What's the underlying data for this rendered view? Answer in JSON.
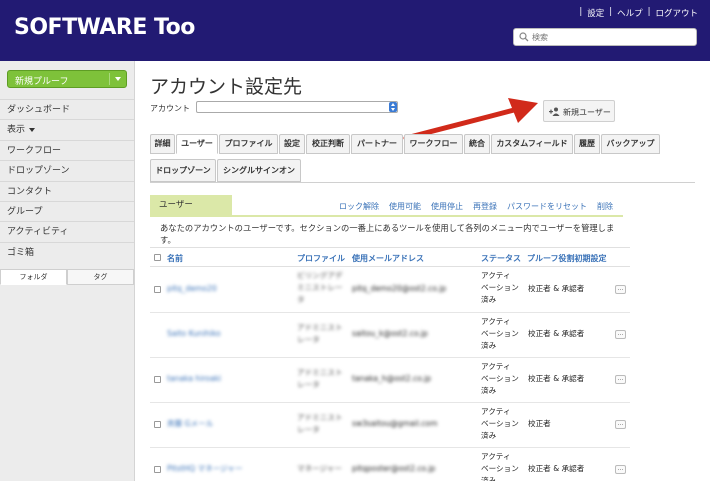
{
  "header": {
    "logo": "SOFTWARE Too",
    "links": [
      "|",
      "設定",
      "|",
      "ヘルプ",
      "|",
      "ログアウト"
    ],
    "search_placeholder": "検索"
  },
  "sidebar": {
    "new_flow_label": "新規プルーフ",
    "items": [
      "ダッシュボード",
      "表示",
      "ワークフロー",
      "ドロップゾーン",
      "コンタクト",
      "グループ",
      "アクティビティ",
      "ゴミ箱"
    ],
    "tabs": [
      "フォルダ",
      "タグ"
    ]
  },
  "main": {
    "title": "アカウント設定先",
    "account_label": "アカウント",
    "new_user_button": "新規ユーザー",
    "tabs": [
      "詳細",
      "ユーザー",
      "プロファイル",
      "設定",
      "校正判断",
      "パートナー",
      "ワークフロー",
      "統合",
      "カスタムフィールド",
      "履歴",
      "バックアップ",
      "ドロップゾーン",
      "シングルサインオン"
    ],
    "active_tab": "ユーザー",
    "section_title": "ユーザー",
    "actions": [
      "ロック解除",
      "使用可能",
      "使用停止",
      "再登録",
      "パスワードをリセット",
      "削除"
    ],
    "description": "あなたのアカウントのユーザーです。セクションの一番上にあるツールを使用して各列のメニュー内でユーザーを管理します。"
  },
  "table": {
    "headers": [
      "名前",
      "プロファイル",
      "使用メールアドレス",
      "ステータス",
      "プルーフ役割初期設定"
    ],
    "rows": [
      {
        "name": "pitq_demo20",
        "profile": [
          "ビリングアデ",
          "ミニストレー",
          "タ"
        ],
        "email": "pitq_demo20@ost2.co.jp",
        "status": [
          "アクティ",
          "ベーション",
          "済み"
        ],
        "role": "校正者 & 承認者",
        "more": "..."
      },
      {
        "name": "Saito Kunihiko",
        "profile": [
          "アドミニスト",
          "レータ"
        ],
        "email": "saitou_k@ost2.co.jp",
        "status": [
          "アクティ",
          "ベーション",
          "済み"
        ],
        "role": "校正者 & 承認者",
        "more": "..."
      },
      {
        "name": "tanaka hiroaki",
        "profile": [
          "アドミニスト",
          "レータ"
        ],
        "email": "tanaka_h@ost2.co.jp",
        "status": [
          "アクティ",
          "ベーション",
          "済み"
        ],
        "role": "校正者 & 承認者",
        "more": "..."
      },
      {
        "name": "斉藤 Gメール",
        "profile": [
          "アドミニスト",
          "レータ"
        ],
        "email": "sw3saitou@gmail.com",
        "status": [
          "アクティ",
          "ベーション",
          "済み"
        ],
        "role": "校正者",
        "more": "..."
      },
      {
        "name": "PitstHQ マネージャー",
        "profile": [
          "マネージャー"
        ],
        "email": "pitqposter@ost2.co.jp",
        "status": [
          "アクティ",
          "ベーション",
          "済み"
        ],
        "role": "校正者 & 承認者",
        "more": "..."
      }
    ]
  },
  "colors": {
    "header_bg": "#221a73",
    "accent_green": "#7ec23a",
    "link_blue": "#3b73b8",
    "section_green": "#dbe8a8",
    "annotation_arrow": "#d12a1a"
  }
}
